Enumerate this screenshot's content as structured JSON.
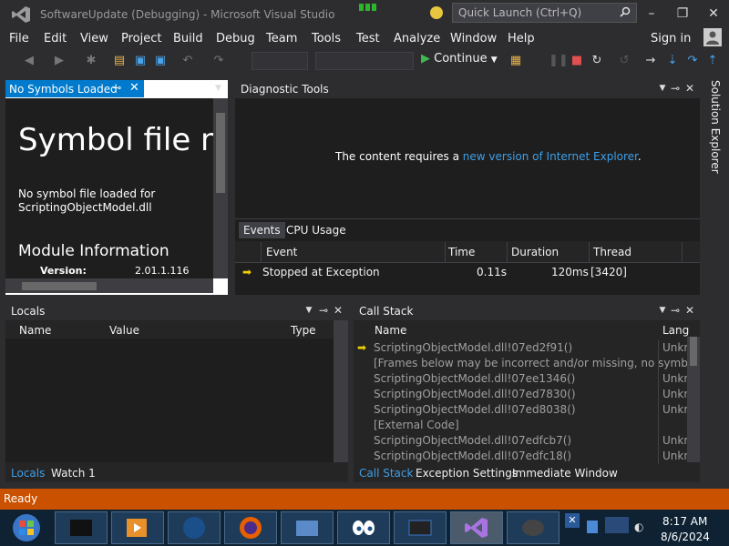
{
  "window": {
    "title": "SoftwareUpdate (Debugging) - Microsoft Visual Studio",
    "quick_launch_placeholder": "Quick Launch (Ctrl+Q)"
  },
  "menu": [
    "File",
    "Edit",
    "View",
    "Project",
    "Build",
    "Debug",
    "Team",
    "Tools",
    "Test",
    "Analyze",
    "Window",
    "Help"
  ],
  "sign_in": "Sign in",
  "toolbar": {
    "continue_label": "Continue"
  },
  "symbols": {
    "tab": "No Symbols Loaded",
    "heading": "Symbol file no",
    "msg_line1": "No symbol file loaded for",
    "msg_line2": "ScriptingObjectModel.dll",
    "module_heading": "Module Information",
    "version_label": "Version:",
    "version_value": "2.01.1.116"
  },
  "diagnostic": {
    "title": "Diagnostic Tools",
    "msg_prefix": "The content requires a ",
    "msg_link": "new version of Internet Explorer",
    "msg_suffix": ".",
    "tabs": [
      "Events",
      "CPU Usage"
    ],
    "columns": [
      "Event",
      "Time",
      "Duration",
      "Thread"
    ],
    "rows": [
      {
        "event": "Stopped at Exception",
        "time": "0.11s",
        "duration": "120ms",
        "thread": "[3420]"
      }
    ]
  },
  "locals": {
    "title": "Locals",
    "columns": [
      "Name",
      "Value",
      "Type"
    ],
    "tabs": [
      "Locals",
      "Watch 1"
    ]
  },
  "callstack": {
    "title": "Call Stack",
    "columns": [
      "Name",
      "Lang"
    ],
    "rows": [
      {
        "name": "ScriptingObjectModel.dll!07ed2f91()",
        "lang": "Unkn"
      },
      {
        "name": "[Frames below may be incorrect and/or missing, no symbo",
        "lang": ""
      },
      {
        "name": "ScriptingObjectModel.dll!07ee1346()",
        "lang": "Unkn"
      },
      {
        "name": "ScriptingObjectModel.dll!07ed7830()",
        "lang": "Unkn"
      },
      {
        "name": "ScriptingObjectModel.dll!07ed8038()",
        "lang": "Unkn"
      },
      {
        "name": "[External Code]",
        "lang": ""
      },
      {
        "name": "ScriptingObjectModel.dll!07edfcb7()",
        "lang": "Unkn"
      },
      {
        "name": "ScriptingObjectModel.dll!07edfc18()",
        "lang": "Unkn"
      }
    ],
    "tabs": [
      "Call Stack",
      "Exception Settings",
      "Immediate Window"
    ]
  },
  "solution_explorer": "Solution Explorer",
  "status": "Ready",
  "taskbar": {
    "time": "8:17 AM",
    "date": "8/6/2024"
  },
  "colors": {
    "accent": "#007acc",
    "status": "#ca5100",
    "link": "#3e9fe8"
  }
}
